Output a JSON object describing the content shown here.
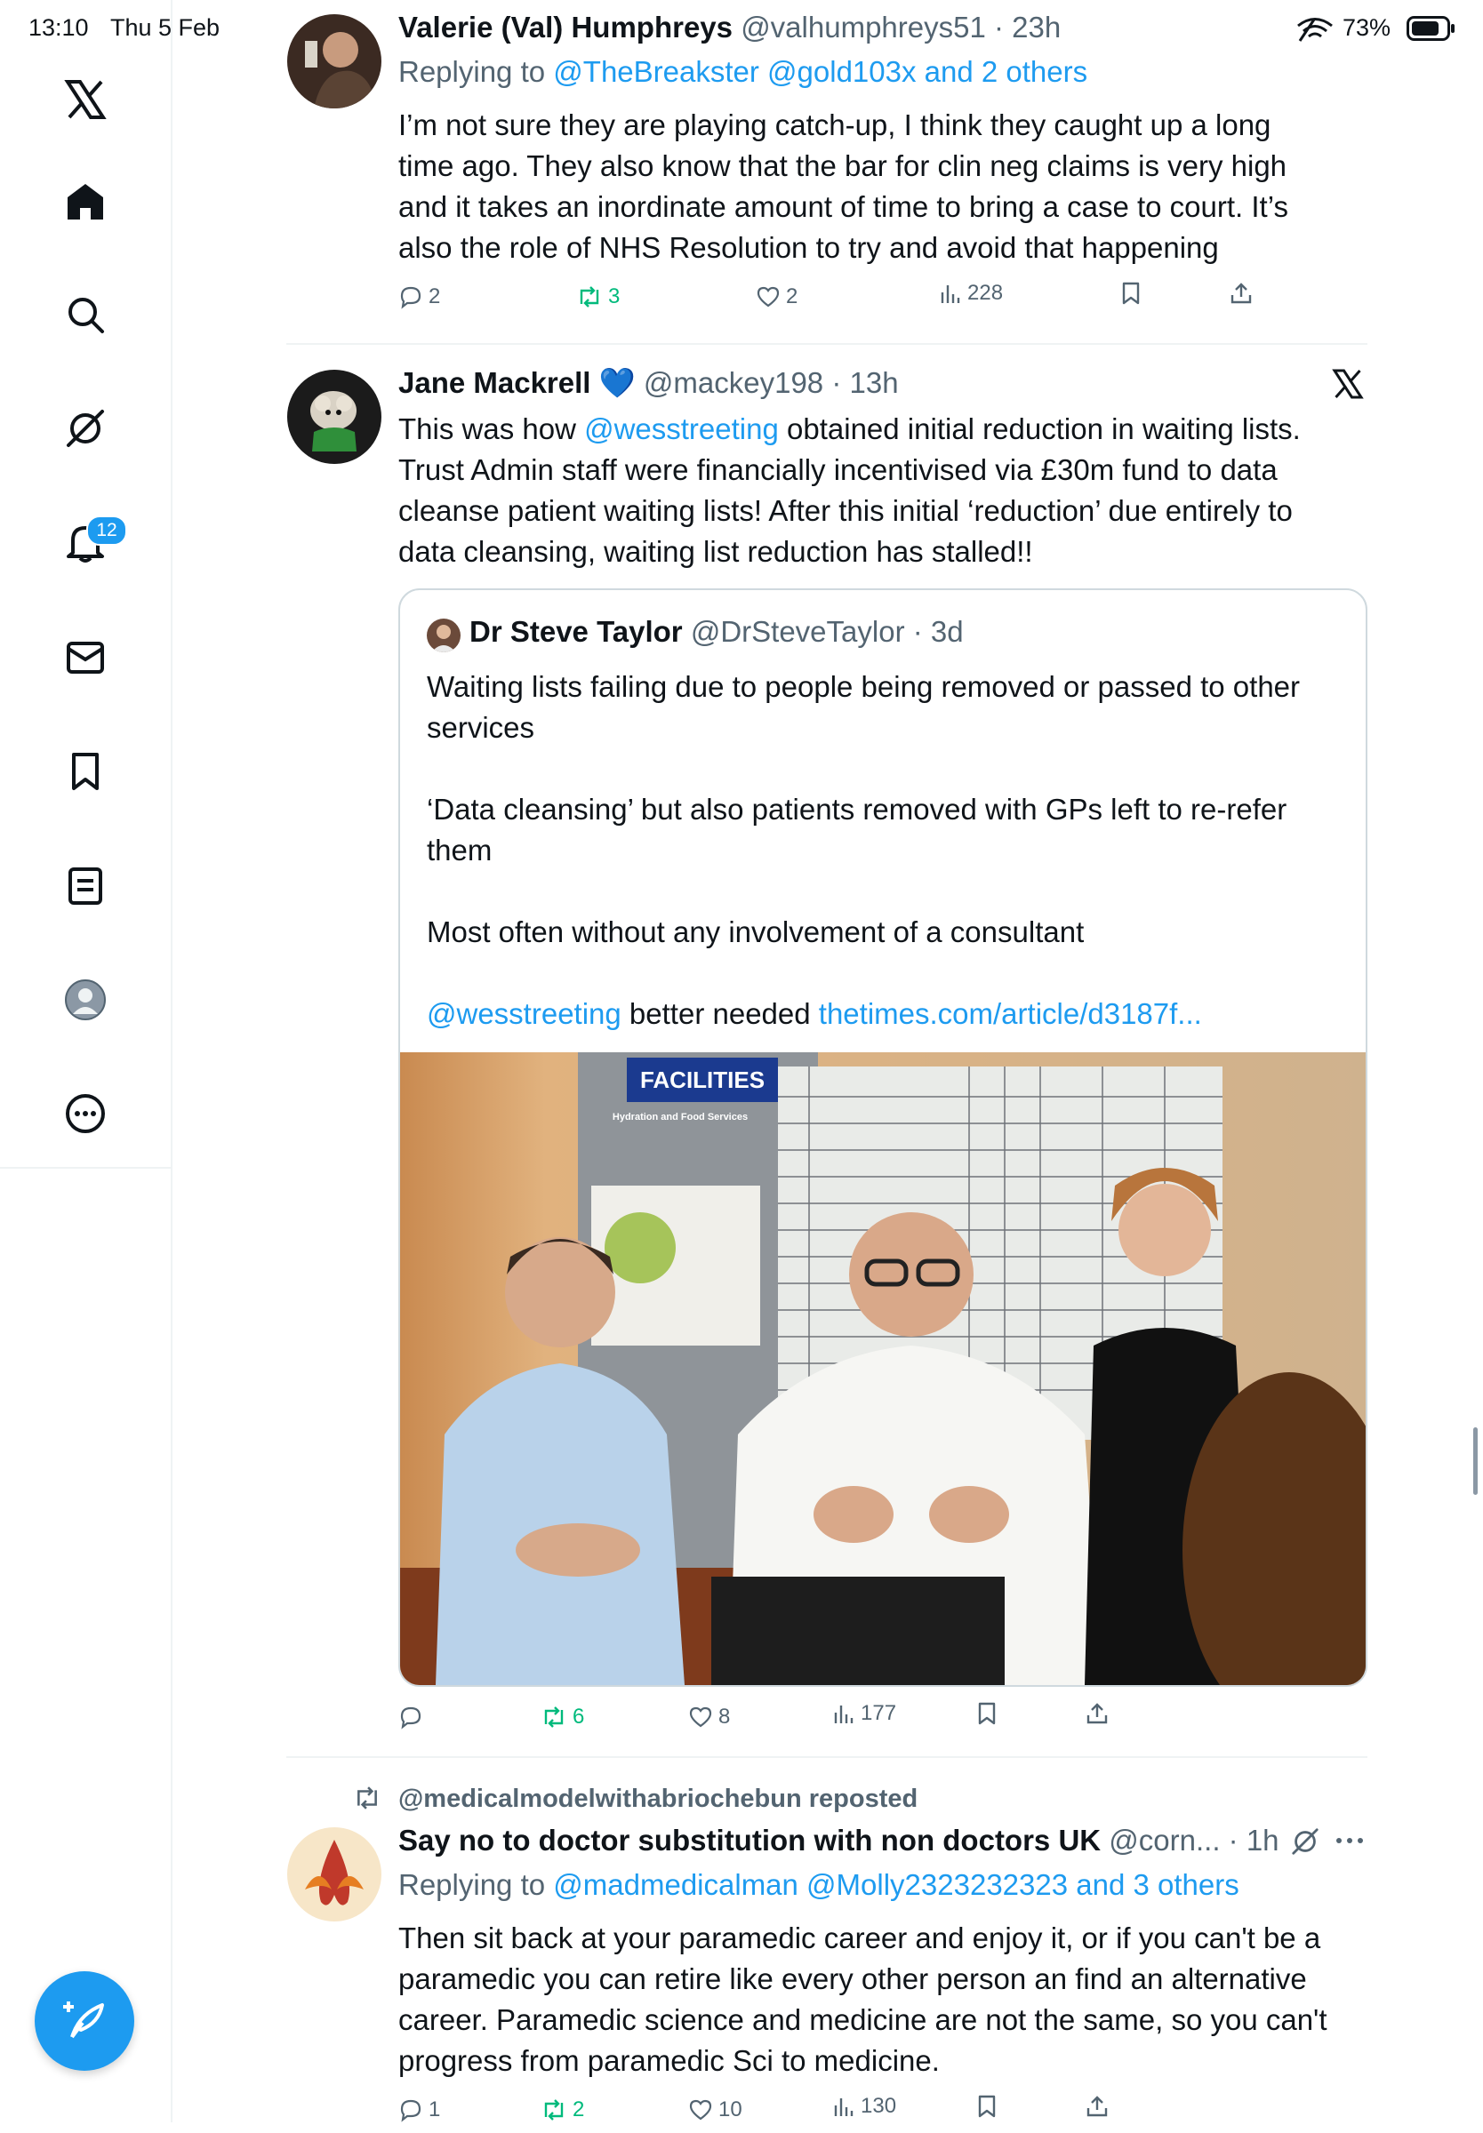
{
  "status_bar": {
    "time": "13:10",
    "date": "Thu 5 Feb",
    "battery": "73%"
  },
  "sidebar": {
    "items": [
      {
        "name": "home"
      },
      {
        "name": "search"
      },
      {
        "name": "grok"
      },
      {
        "name": "notifications",
        "badge": "12"
      },
      {
        "name": "messages"
      },
      {
        "name": "bookmarks"
      },
      {
        "name": "lists"
      },
      {
        "name": "profile"
      },
      {
        "name": "more"
      }
    ]
  },
  "tweets": [
    {
      "name": "Valerie (Val) Humphreys",
      "handle": "@valhumphreys51",
      "time": "· 23h",
      "replying_prefix": "Replying to",
      "replying_to": "@TheBreakster @gold103x and 2 others",
      "lines": [
        "I’m not sure they are playing catch-up, I think they caught up a long",
        "time ago. They also know that the bar for clin neg claims is very high",
        "and it takes an inordinate amount of time to bring a case to court. It’s",
        "also the role of NHS Resolution to try and avoid that happening"
      ],
      "replies": "2",
      "reposts": "3",
      "likes": "2",
      "views": "228"
    },
    {
      "name": "Jane Mackrell",
      "emoji": "💙",
      "handle": "@mackey198",
      "time": "· 13h",
      "line1_prefix": "This was how ",
      "line1_mention": "@wesstreeting",
      "line1_suffix": " obtained initial reduction in waiting lists.",
      "lines": [
        "Trust Admin staff were financially incentivised via £30m fund to data",
        "cleanse patient waiting lists! After this initial ‘reduction’ due entirely to",
        "data cleansing, waiting list reduction has stalled!!"
      ],
      "quote": {
        "name": "Dr Steve Taylor",
        "handle": "@DrSteveTaylor",
        "time": "· 3d",
        "lines": [
          "Waiting lists failing due to people being removed or passed to other",
          "services",
          "",
          "‘Data cleansing’ but also patients removed with GPs left to re-refer",
          "them",
          "",
          "Most often without any involvement of a consultant"
        ],
        "mention": "@wesstreeting",
        "middle_text": " better needed ",
        "link": "thetimes.com/article/d3187f...",
        "photo_sign_title": "FACILITIES",
        "photo_sign_subtitle": "Hydration and Food Services"
      },
      "replies": "",
      "reposts": "6",
      "likes": "8",
      "views": "177"
    },
    {
      "reposted_by": "@medicalmodelwithabriochebun reposted",
      "name": "Say no to doctor substitution with non doctors UK",
      "handle": "@corn...",
      "time": "· 1h",
      "replying_prefix": "Replying to",
      "replying_to": "@madmedicalman @Molly2323232323 and 3 others",
      "lines": [
        "Then sit back at your paramedic career and enjoy it, or if you can't be a",
        "paramedic you can retire like every other person an find an alternative",
        "career. Paramedic science and medicine are not the same, so you can't",
        "progress from paramedic Sci to medicine."
      ],
      "replies": "1",
      "reposts": "2",
      "likes": "10",
      "views": "130"
    }
  ]
}
